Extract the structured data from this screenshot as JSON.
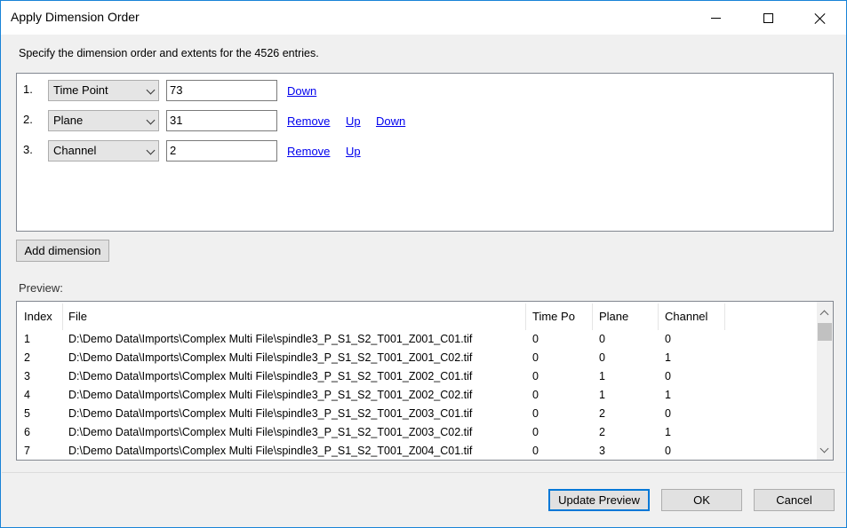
{
  "window": {
    "title": "Apply Dimension Order",
    "controls": [
      "minimize-icon",
      "maximize-icon",
      "close-icon"
    ]
  },
  "instruction": "Specify the dimension order and extents for the 4526 entries.",
  "dimensions": [
    {
      "index": "1.",
      "type": "Time Point",
      "extent": "73",
      "links": [
        "Down"
      ]
    },
    {
      "index": "2.",
      "type": "Plane",
      "extent": "31",
      "links": [
        "Remove",
        "Up",
        "Down"
      ]
    },
    {
      "index": "3.",
      "type": "Channel",
      "extent": "2",
      "links": [
        "Remove",
        "Up"
      ]
    }
  ],
  "add_dimension_label": "Add dimension",
  "preview": {
    "label": "Preview:",
    "columns": [
      "Index",
      "File",
      "Time Po",
      "Plane",
      "Channel"
    ],
    "rows": [
      [
        "1",
        "D:\\Demo Data\\Imports\\Complex Multi File\\spindle3_P_S1_S2_T001_Z001_C01.tif",
        "0",
        "0",
        "0"
      ],
      [
        "2",
        "D:\\Demo Data\\Imports\\Complex Multi File\\spindle3_P_S1_S2_T001_Z001_C02.tif",
        "0",
        "0",
        "1"
      ],
      [
        "3",
        "D:\\Demo Data\\Imports\\Complex Multi File\\spindle3_P_S1_S2_T001_Z002_C01.tif",
        "0",
        "1",
        "0"
      ],
      [
        "4",
        "D:\\Demo Data\\Imports\\Complex Multi File\\spindle3_P_S1_S2_T001_Z002_C02.tif",
        "0",
        "1",
        "1"
      ],
      [
        "5",
        "D:\\Demo Data\\Imports\\Complex Multi File\\spindle3_P_S1_S2_T001_Z003_C01.tif",
        "0",
        "2",
        "0"
      ],
      [
        "6",
        "D:\\Demo Data\\Imports\\Complex Multi File\\spindle3_P_S1_S2_T001_Z003_C02.tif",
        "0",
        "2",
        "1"
      ],
      [
        "7",
        "D:\\Demo Data\\Imports\\Complex Multi File\\spindle3_P_S1_S2_T001_Z004_C01.tif",
        "0",
        "3",
        "0"
      ]
    ]
  },
  "footer": {
    "update_preview": "Update Preview",
    "ok": "OK",
    "cancel": "Cancel"
  },
  "colors": {
    "link": "#0000ee",
    "accent": "#0078d7",
    "window_border": "#1883d7"
  }
}
